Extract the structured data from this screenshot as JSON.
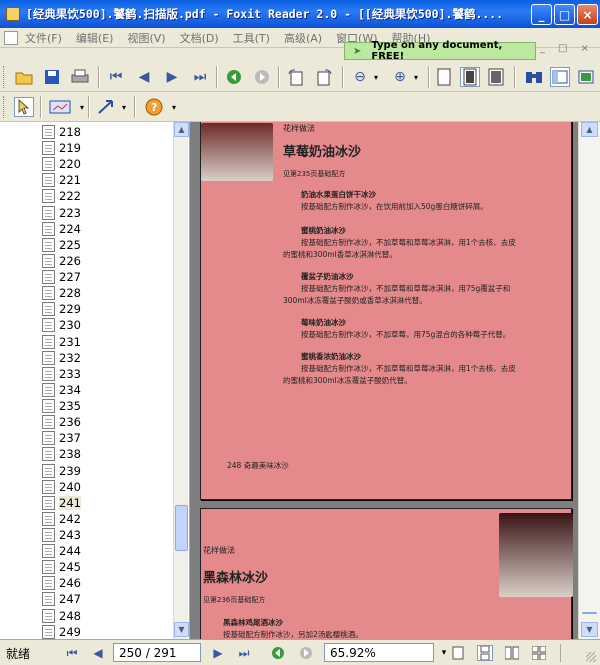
{
  "window": {
    "title": "[经典果饮500].饕鹤.扫描版.pdf - Foxit Reader 2.0 - [[经典果饮500].饕鹤....",
    "minimize": "_",
    "maximize": "□",
    "close": "×"
  },
  "menu": [
    "文件(F)",
    "编辑(E)",
    "视图(V)",
    "文档(D)",
    "工具(T)",
    "高级(A)",
    "窗口(W)",
    "帮助(H)"
  ],
  "ad": {
    "text": "Type on any document, FREE!"
  },
  "mdi_icons": "_ □ ×",
  "sidebar": {
    "pages": [
      "218",
      "219",
      "220",
      "221",
      "222",
      "223",
      "224",
      "225",
      "226",
      "227",
      "228",
      "229",
      "230",
      "231",
      "232",
      "233",
      "234",
      "235",
      "236",
      "237",
      "238",
      "239",
      "240",
      "241",
      "242",
      "243",
      "244",
      "245",
      "246",
      "247",
      "248",
      "249"
    ],
    "selected": "241"
  },
  "page1": {
    "section": "花样做法",
    "heading": "草莓奶油冰沙",
    "ref": "见第235页基础配方",
    "items": [
      {
        "title": "奶油水果蛋白饼干冰沙",
        "lines": [
          "按基础配方制作冰沙，在饮用前加入50g蛋白糖饼碎屑。"
        ]
      },
      {
        "title": "蜜桃奶油冰沙",
        "lines": [
          "按基础配方制作冰沙，不加草莓和草莓冰淇淋，用1个去核、去皮",
          "的蜜桃和300ml香草冰淇淋代替。"
        ]
      },
      {
        "title": "覆盆子奶油冰沙",
        "lines": [
          "按基础配方制作冰沙，不加草莓和草莓冰淇淋，用75g覆盆子和",
          "300ml冰冻覆盆子酸奶或香草冰淇淋代替。"
        ]
      },
      {
        "title": "莓味奶油冰沙",
        "lines": [
          "按基础配方制作冰沙，不加草莓，用75g混合的各种莓子代替。"
        ]
      },
      {
        "title": "蜜桃香浓奶油冰沙",
        "lines": [
          "按基础配方制作冰沙，不加草莓和草莓冰淇淋，用1个去核、去皮",
          "的蜜桃和300ml冰冻覆盆子酸奶代替。"
        ]
      }
    ],
    "footer": "248  奇趣美味冰沙"
  },
  "page2": {
    "section": "花样做法",
    "heading": "黑森林冰沙",
    "ref": "见第236页基础配方",
    "items": [
      {
        "title": "黑森林鸡尾酒冰沙",
        "lines": [
          "按基础配方制作冰沙，另加2汤匙樱桃酒。"
        ]
      }
    ]
  },
  "status": {
    "ready": "就绪",
    "page": "250 / 291",
    "zoom": "65.92%"
  }
}
